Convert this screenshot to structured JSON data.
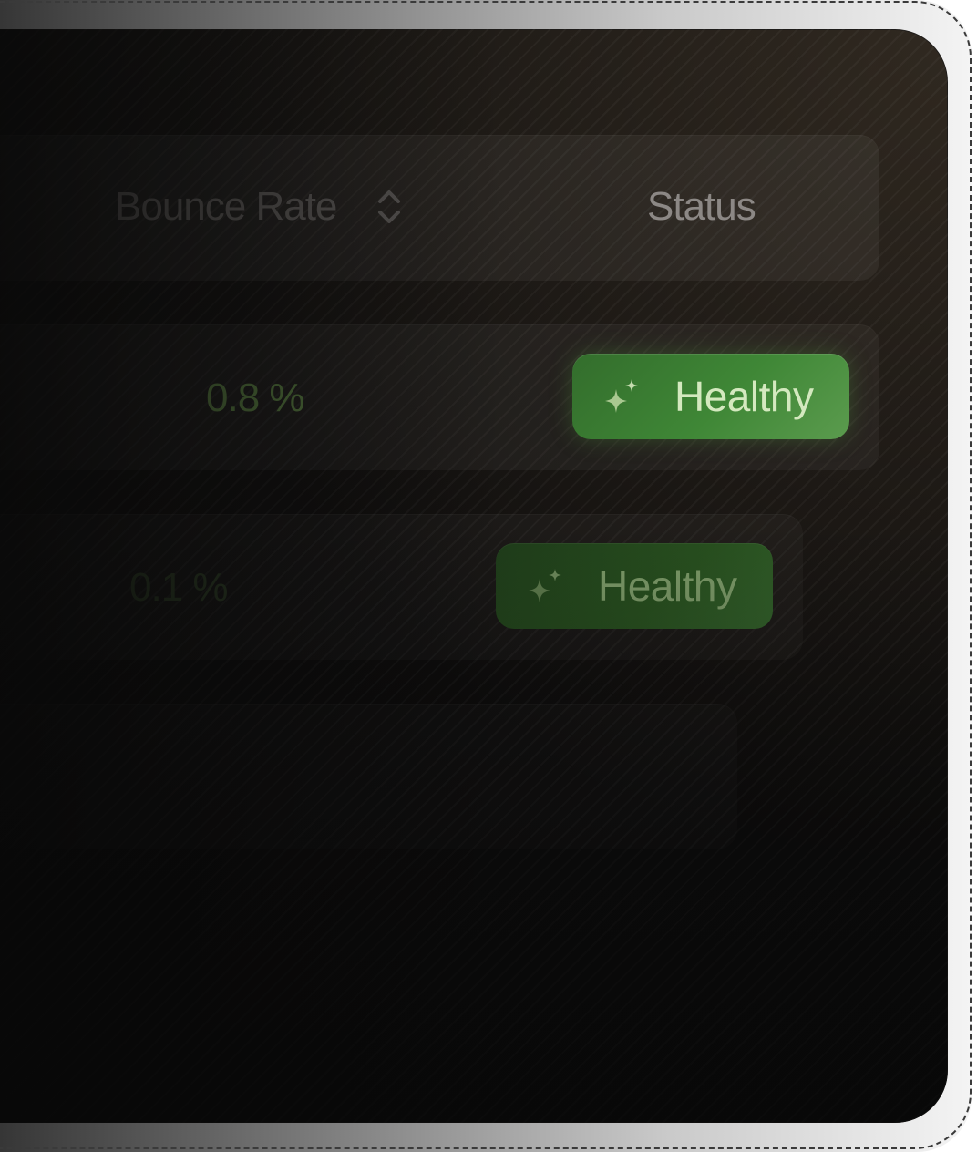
{
  "table": {
    "columns": {
      "bounce_rate": "Bounce Rate",
      "status": "Status"
    },
    "rows": [
      {
        "bounce_rate": "0.8 %",
        "status": "Healthy"
      },
      {
        "bounce_rate": "0.1 %",
        "status": "Healthy"
      },
      {
        "bounce_rate": "",
        "status": ""
      }
    ]
  },
  "colors": {
    "healthy_badge": "#3f8736",
    "healthy_text": "#d4e9bf",
    "positive_value": "#4f6e3a"
  },
  "icons": {
    "sort": "chevron-up-down-icon",
    "status_badge": "sparkles-icon"
  }
}
